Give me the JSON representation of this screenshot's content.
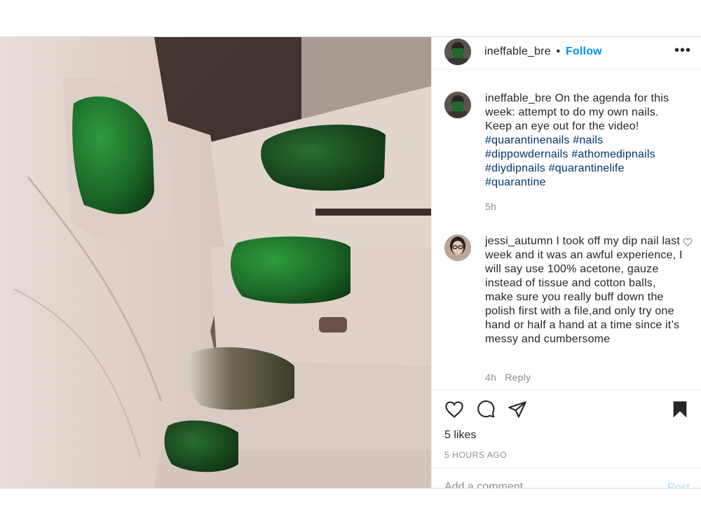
{
  "post": {
    "author": "ineffable_bre",
    "follow_label": "Follow",
    "separator": "•",
    "more_label": "•••"
  },
  "caption": {
    "username": "ineffable_bre",
    "text": " On the agenda for this week: attempt to do my own nails. Keep an eye out for the video! ",
    "hashtags": [
      "#quarantinenails",
      "#nails",
      "#dippowdernails",
      "#athomedipnails",
      "#diydipnails",
      "#quarantinelife",
      "#quarantine"
    ],
    "time": "5h"
  },
  "comment": {
    "username": "jessi_autumn",
    "text": " I took off my dip nail last week and it was an awful experience, I will say use 100% acetone, gauze instead of tissue and cotton balls, make sure you really buff down the polish first with a file,and only try one hand or half a hand at a time since it’s messy and cumbersome",
    "time": "4h",
    "reply_label": "Reply"
  },
  "actions": {
    "likes": "5 likes",
    "timestamp": "5 HOURS AGO",
    "icons": [
      "heart-icon",
      "comment-icon",
      "share-icon",
      "bookmark-icon"
    ]
  },
  "add_comment": {
    "placeholder": "Add a comment…",
    "post_label": "Post"
  },
  "colors": {
    "link": "#00376b",
    "follow": "#0095f6",
    "post_disabled": "#b2dffc",
    "secondary_text": "#8e8e8e",
    "nail_green": "#1f7a2c"
  }
}
